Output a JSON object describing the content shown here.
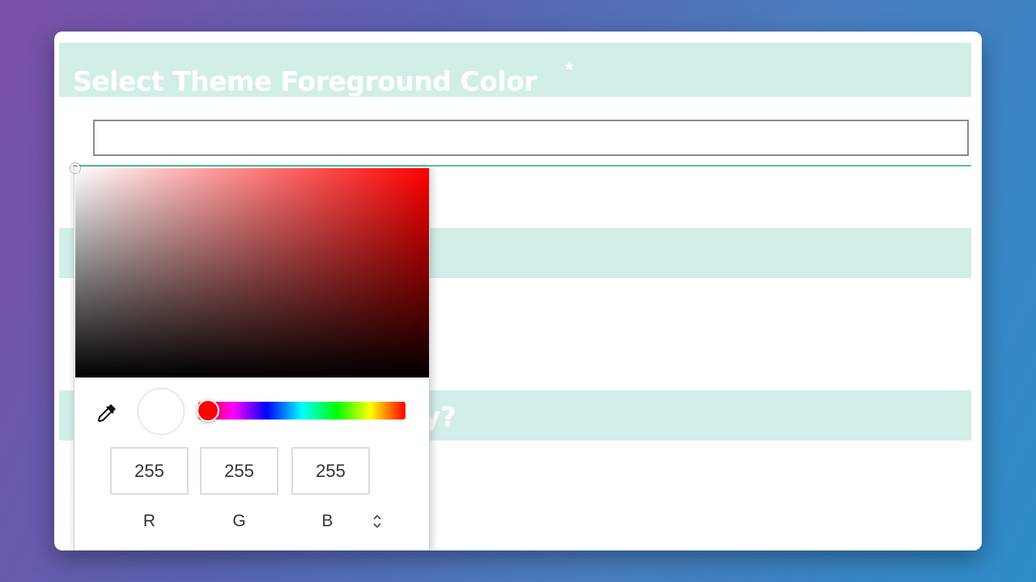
{
  "form": {
    "section1": {
      "title": "Select Theme Foreground Color",
      "required_marker": "*"
    },
    "color_input": {
      "value": ""
    },
    "section3": {
      "partial_text": "y?"
    }
  },
  "picker": {
    "selected_color": "#ffffff",
    "hue_color": "#ff0000",
    "rgb": {
      "r": "255",
      "g": "255",
      "b": "255"
    },
    "labels": {
      "r": "R",
      "g": "G",
      "b": "B"
    },
    "icons": {
      "eyedropper": "eyedropper-icon",
      "mode_toggle": "up-down-chevron-icon"
    }
  },
  "colors": {
    "header_bg": "#d2eee8",
    "accent": "#58c0a6"
  }
}
